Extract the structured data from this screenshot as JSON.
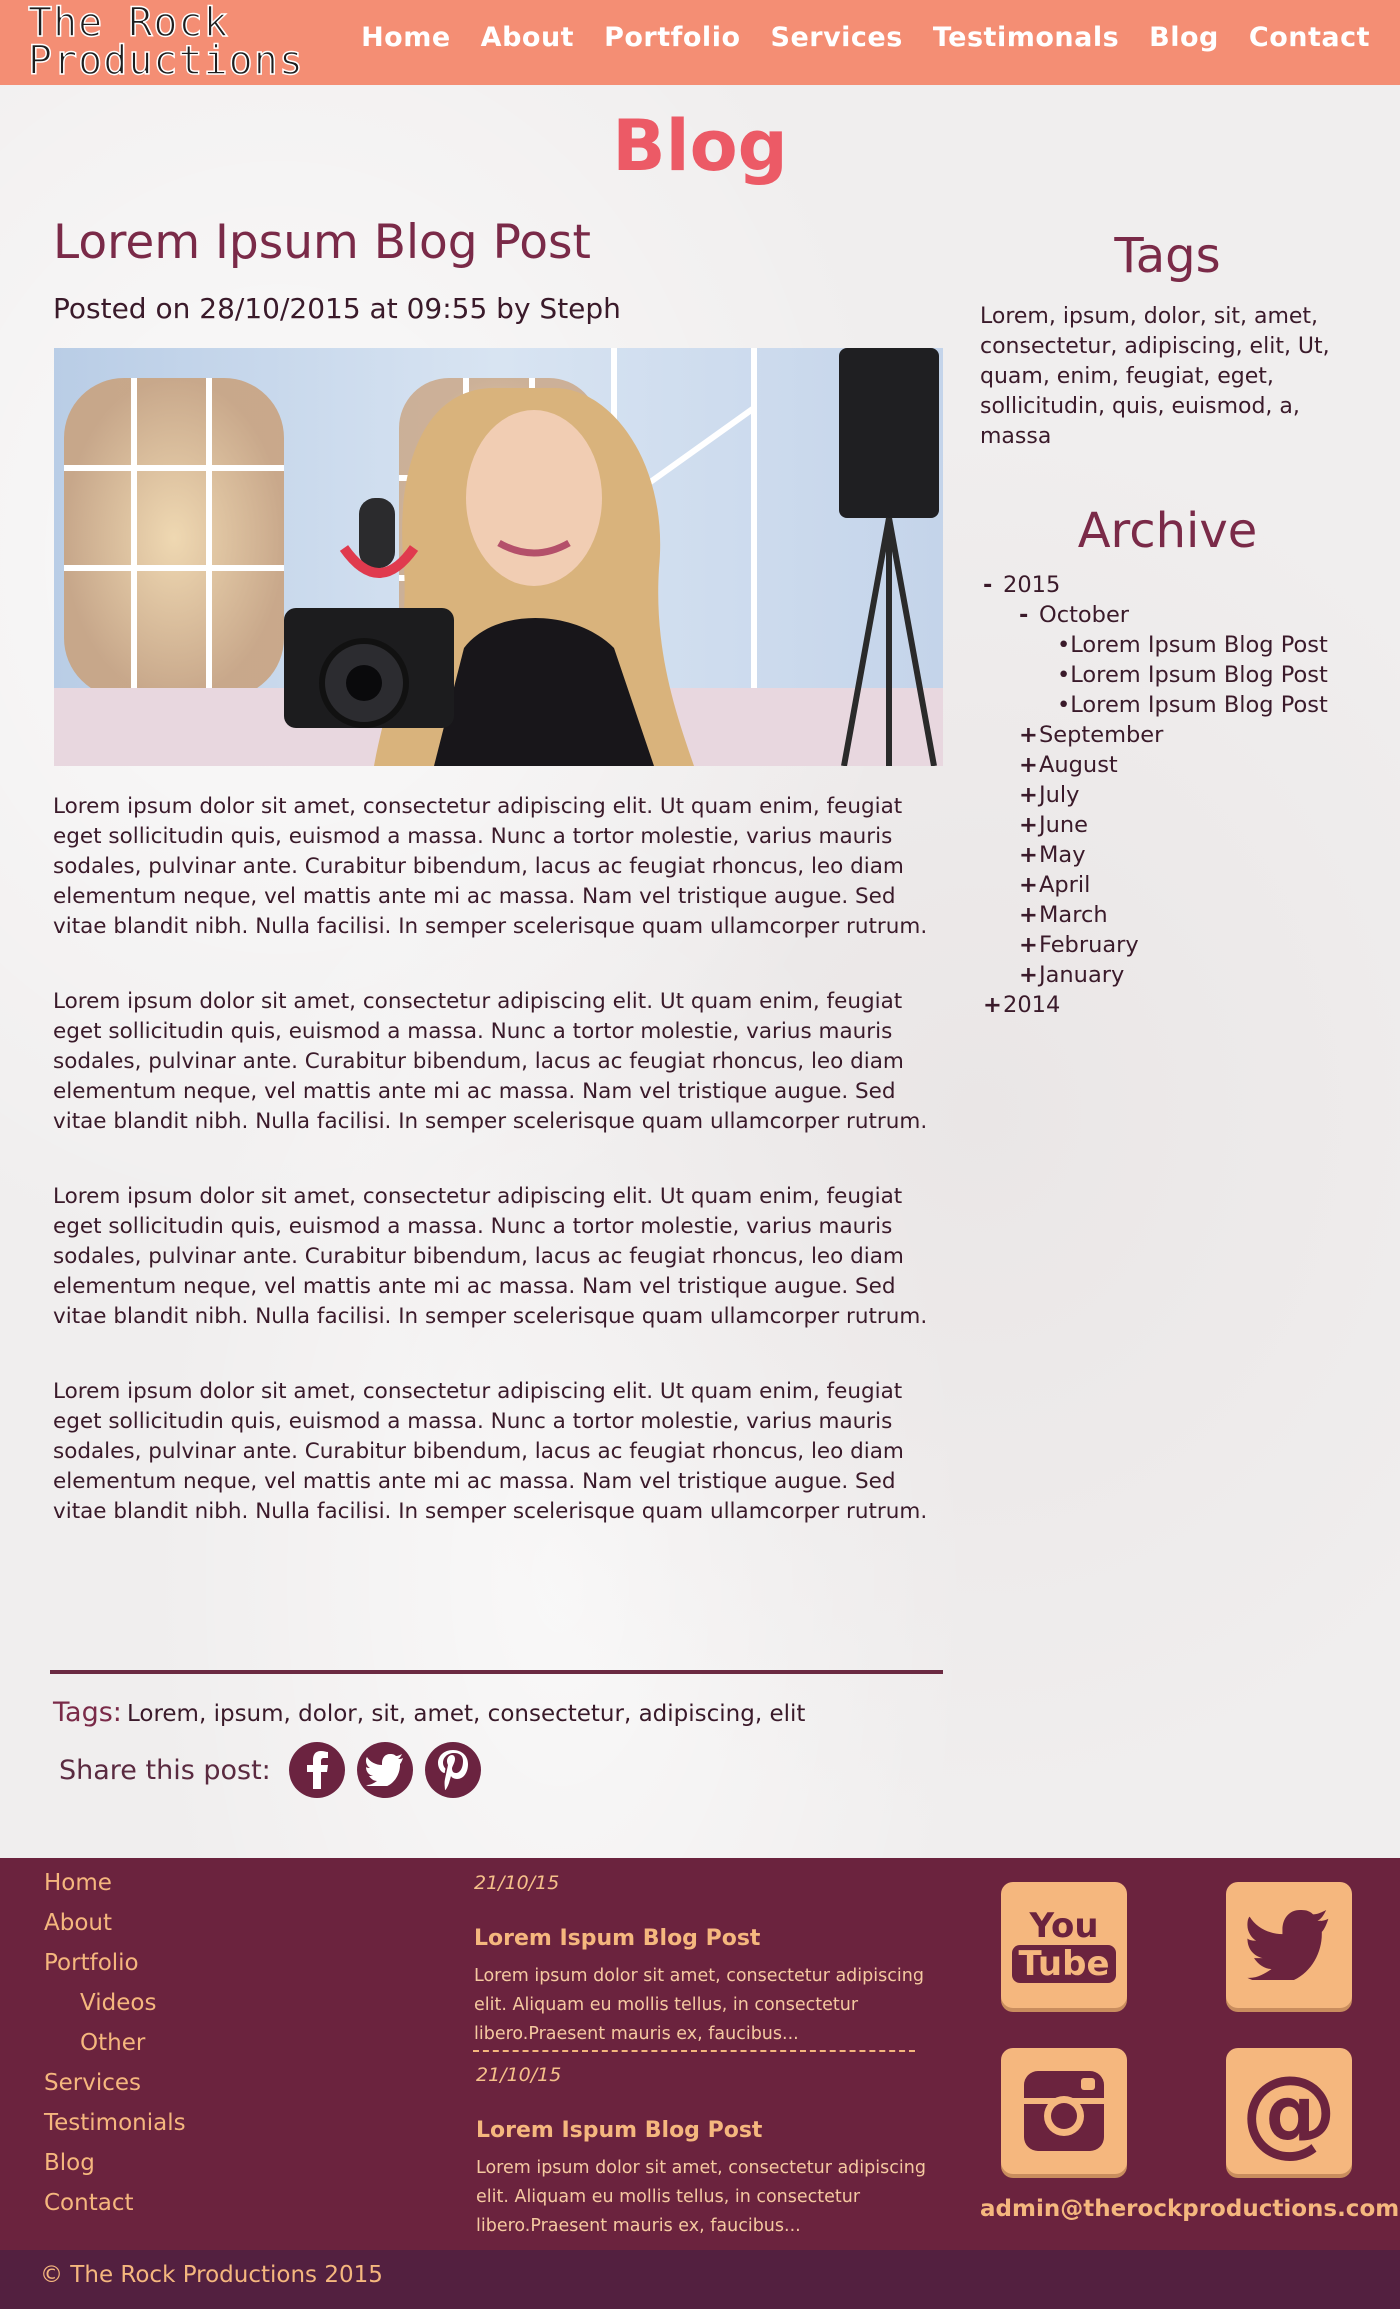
{
  "header": {
    "logo_line1": "The Rock",
    "logo_line2": "Productions",
    "nav": [
      "Home",
      "About",
      "Portfolio",
      "Services",
      "Testimonals",
      "Blog",
      "Contact"
    ]
  },
  "page_title": "Blog",
  "post": {
    "title": "Lorem Ipsum Blog Post",
    "meta": "Posted on 28/10/2015 at 09:55 by Steph",
    "paragraphs": [
      "Lorem ipsum dolor sit amet, consectetur adipiscing elit. Ut quam enim, feugiat eget sollicitudin quis, euismod a massa. Nunc a tortor molestie, varius mauris sodales, pulvinar ante. Curabitur bibendum, lacus ac feugiat rhoncus, leo diam elementum neque, vel mattis ante mi ac massa. Nam vel tristique augue. Sed vitae blandit nibh. Nulla facilisi. In semper scelerisque quam ullamcorper rutrum.",
      "Lorem ipsum dolor sit amet, consectetur adipiscing elit. Ut quam enim, feugiat eget sollicitudin quis, euismod a massa. Nunc a tortor molestie, varius mauris sodales, pulvinar ante. Curabitur bibendum, lacus ac feugiat rhoncus, leo diam elementum neque, vel mattis ante mi ac massa. Nam vel tristique augue. Sed vitae blandit nibh. Nulla facilisi. In semper scelerisque quam ullamcorper rutrum.",
      "Lorem ipsum dolor sit amet, consectetur adipiscing elit. Ut quam enim, feugiat eget sollicitudin quis, euismod a massa. Nunc a tortor molestie, varius mauris sodales, pulvinar ante. Curabitur bibendum, lacus ac feugiat rhoncus, leo diam elementum neque, vel mattis ante mi ac massa. Nam vel tristique augue. Sed vitae blandit nibh. Nulla facilisi. In semper scelerisque quam ullamcorper rutrum.",
      "Lorem ipsum dolor sit amet, consectetur adipiscing elit. Ut quam enim, feugiat eget sollicitudin quis, euismod a massa. Nunc a tortor molestie, varius mauris sodales, pulvinar ante. Curabitur bibendum, lacus ac feugiat rhoncus, leo diam elementum neque, vel mattis ante mi ac massa. Nam vel tristique augue. Sed vitae blandit nibh. Nulla facilisi. In semper scelerisque quam ullamcorper rutrum."
    ],
    "tags_label": "Tags:",
    "tags_values": "Lorem, ipsum, dolor, sit, amet, consectetur, adipiscing, elit",
    "share_label": "Share this post:",
    "share_icons": [
      "facebook-icon",
      "twitter-icon",
      "pinterest-icon"
    ]
  },
  "sidebar": {
    "tags_heading": "Tags",
    "tags_text": "Lorem, ipsum, dolor, sit, amet, consectetur, adipiscing, elit, Ut, quam, enim, feugiat, eget, sollicitudin, quis, euismod, a, massa",
    "archive_heading": "Archive",
    "archive": {
      "year_2015": "2015",
      "month_october": "October",
      "october_posts": [
        "Lorem Ipsum Blog Post",
        "Lorem Ipsum Blog Post",
        "Lorem Ipsum Blog Post"
      ],
      "other_months": [
        "September",
        "August",
        "July",
        "June",
        "May",
        "April",
        "March",
        "February",
        "January"
      ],
      "year_2014": "2014",
      "expanded_symbol": "-",
      "collapsed_symbol": "+",
      "bullet_symbol": "•"
    }
  },
  "footer": {
    "links": [
      "Home",
      "About",
      "Portfolio",
      "Videos",
      "Other",
      "Services",
      "Testimonials",
      "Blog",
      "Contact"
    ],
    "news": [
      {
        "date": "21/10/15",
        "title": "Lorem Ispum Blog Post",
        "excerpt": "Lorem ipsum dolor sit amet, consectetur adipiscing elit. Aliquam eu mollis tellus, in consectetur libero.Praesent mauris ex, faucibus..."
      },
      {
        "date": "21/10/15",
        "title": "Lorem Ispum Blog Post",
        "excerpt": "Lorem ipsum dolor sit amet, consectetur adipiscing elit. Aliquam eu mollis tellus, in consectetur libero.Praesent mauris ex, faucibus..."
      }
    ],
    "social": {
      "youtube_line1": "You",
      "youtube_line2": "Tube",
      "at_symbol": "@"
    },
    "email": "admin@therockproductions.com",
    "copyright": "© The Rock Productions 2015"
  },
  "colors": {
    "header_bg": "#f48e74",
    "title_red": "#ec5a66",
    "heading_plum": "#7a2a48",
    "footer_bg": "#6b233e",
    "footer_accent": "#f5b77e",
    "copyright_bg": "#532040"
  }
}
